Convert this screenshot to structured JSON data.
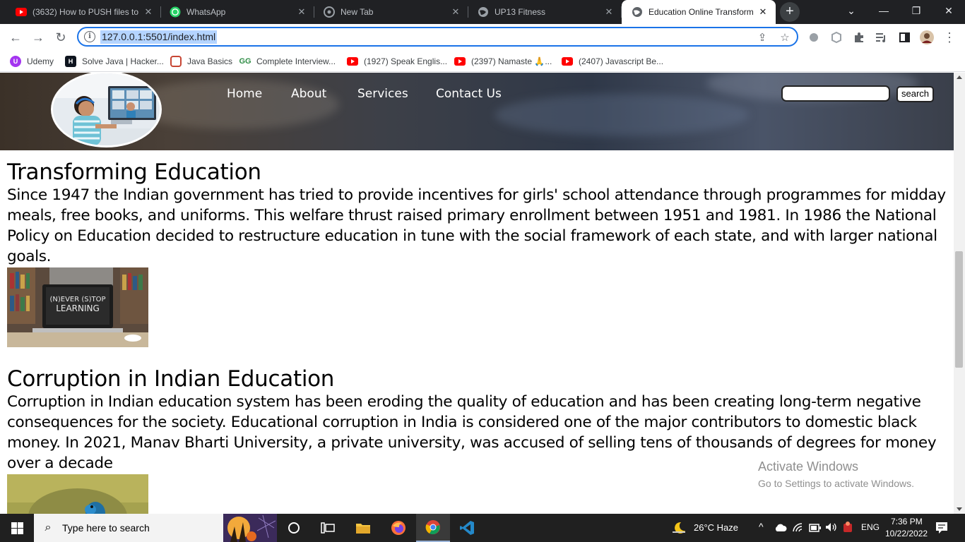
{
  "browser": {
    "tabs": [
      {
        "title": "(3632) How to PUSH files to",
        "icon": "youtube-icon"
      },
      {
        "title": "WhatsApp",
        "icon": "whatsapp-icon"
      },
      {
        "title": "New Tab",
        "icon": "chrome-icon"
      },
      {
        "title": "UP13 Fitness",
        "icon": "globe-icon"
      },
      {
        "title": "Education Online Transform",
        "icon": "globe-icon",
        "active": true
      }
    ],
    "url": "127.0.0.1:5501/index.html",
    "bookmarks": [
      {
        "label": "Udemy",
        "icon": "udemy-icon"
      },
      {
        "label": "Solve Java | Hacker...",
        "icon": "hackerrank-icon"
      },
      {
        "label": "Java Basics",
        "icon": "oracle-icon"
      },
      {
        "label": "Complete Interview...",
        "icon": "gfg-icon"
      },
      {
        "label": "(1927) Speak Englis...",
        "icon": "youtube-icon"
      },
      {
        "label": "(2397) Namaste 🙏...",
        "icon": "youtube-icon"
      },
      {
        "label": "(2407) Javascript Be...",
        "icon": "youtube-icon"
      }
    ]
  },
  "site": {
    "nav": [
      "Home",
      "About",
      "Services",
      "Contact Us"
    ],
    "search": {
      "value": "",
      "button": "search"
    },
    "articles": [
      {
        "title": "Transforming Education",
        "body": "Since 1947 the Indian government has tried to provide incentives for girls' school attendance through programmes for midday meals, free books, and uniforms. This welfare thrust raised primary enrollment between 1951 and 1981. In 1986 the National Policy on Education decided to restructure education in tune with the social framework of each state, and with larger national goals.",
        "image_text": "(N)EVER (S)TOP LEARNING"
      },
      {
        "title": "Corruption in Indian Education",
        "body": "Corruption in Indian education system has been eroding the quality of education and has been creating long-term negative consequences for the society. Educational corruption in India is considered one of the major contributors to domestic black money. In 2021, Manav Bharti University, a private university, was accused of selling tens of thousands of degrees for money over a decade"
      }
    ]
  },
  "watermark": {
    "line1": "Activate Windows",
    "line2": "Go to Settings to activate Windows."
  },
  "taskbar": {
    "search_placeholder": "Type here to search",
    "weather": "26°C  Haze",
    "language": "ENG",
    "time": "7:36 PM",
    "date": "10/22/2022"
  },
  "colors": {
    "accent": "#1a73e8",
    "tabstrip": "#202124",
    "taskbar": "#202020"
  }
}
